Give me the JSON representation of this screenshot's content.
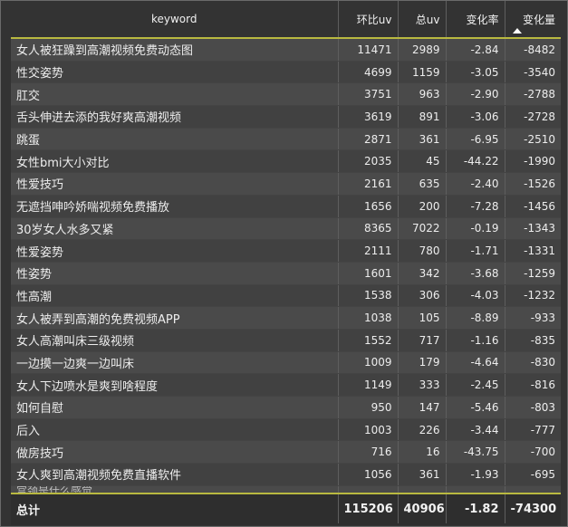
{
  "columns": {
    "keyword": "keyword",
    "prev_uv": "环比uv",
    "total_uv": "总uv",
    "change_rate": "变化率",
    "change_amount": "变化量"
  },
  "rows": [
    {
      "keyword": "女人被狂躁到高潮视频免费动态图",
      "prev_uv": "11471",
      "total_uv": "2989",
      "change_rate": "-2.84",
      "change_amount": "-8482"
    },
    {
      "keyword": "性交姿势",
      "prev_uv": "4699",
      "total_uv": "1159",
      "change_rate": "-3.05",
      "change_amount": "-3540"
    },
    {
      "keyword": "肛交",
      "prev_uv": "3751",
      "total_uv": "963",
      "change_rate": "-2.90",
      "change_amount": "-2788"
    },
    {
      "keyword": "舌头伸进去添的我好爽高潮视频",
      "prev_uv": "3619",
      "total_uv": "891",
      "change_rate": "-3.06",
      "change_amount": "-2728"
    },
    {
      "keyword": "跳蛋",
      "prev_uv": "2871",
      "total_uv": "361",
      "change_rate": "-6.95",
      "change_amount": "-2510"
    },
    {
      "keyword": "女性bmi大小对比",
      "prev_uv": "2035",
      "total_uv": "45",
      "change_rate": "-44.22",
      "change_amount": "-1990"
    },
    {
      "keyword": "性爱技巧",
      "prev_uv": "2161",
      "total_uv": "635",
      "change_rate": "-2.40",
      "change_amount": "-1526"
    },
    {
      "keyword": "无遮挡呻吟娇喘视频免费播放",
      "prev_uv": "1656",
      "total_uv": "200",
      "change_rate": "-7.28",
      "change_amount": "-1456"
    },
    {
      "keyword": "30岁女人水多又紧",
      "prev_uv": "8365",
      "total_uv": "7022",
      "change_rate": "-0.19",
      "change_amount": "-1343"
    },
    {
      "keyword": "性爱姿势",
      "prev_uv": "2111",
      "total_uv": "780",
      "change_rate": "-1.71",
      "change_amount": "-1331"
    },
    {
      "keyword": "性姿势",
      "prev_uv": "1601",
      "total_uv": "342",
      "change_rate": "-3.68",
      "change_amount": "-1259"
    },
    {
      "keyword": "性高潮",
      "prev_uv": "1538",
      "total_uv": "306",
      "change_rate": "-4.03",
      "change_amount": "-1232"
    },
    {
      "keyword": "女人被弄到高潮的免费视频APP",
      "prev_uv": "1038",
      "total_uv": "105",
      "change_rate": "-8.89",
      "change_amount": "-933"
    },
    {
      "keyword": "女人高潮叫床三级视频",
      "prev_uv": "1552",
      "total_uv": "717",
      "change_rate": "-1.16",
      "change_amount": "-835"
    },
    {
      "keyword": "一边摸一边爽一边叫床",
      "prev_uv": "1009",
      "total_uv": "179",
      "change_rate": "-4.64",
      "change_amount": "-830"
    },
    {
      "keyword": "女人下边喷水是爽到啥程度",
      "prev_uv": "1149",
      "total_uv": "333",
      "change_rate": "-2.45",
      "change_amount": "-816"
    },
    {
      "keyword": "如何自慰",
      "prev_uv": "950",
      "total_uv": "147",
      "change_rate": "-5.46",
      "change_amount": "-803"
    },
    {
      "keyword": "后入",
      "prev_uv": "1003",
      "total_uv": "226",
      "change_rate": "-3.44",
      "change_amount": "-777"
    },
    {
      "keyword": "做房技巧",
      "prev_uv": "716",
      "total_uv": "16",
      "change_rate": "-43.75",
      "change_amount": "-700"
    },
    {
      "keyword": "女人爽到高潮视频免费直播软件",
      "prev_uv": "1056",
      "total_uv": "361",
      "change_rate": "-1.93",
      "change_amount": "-695"
    }
  ],
  "partial_row": {
    "keyword": "宫颈是什么感觉",
    "prev_uv": "",
    "total_uv": "",
    "change_rate": "",
    "change_amount": ""
  },
  "totals": {
    "label": "总计",
    "prev_uv": "115206",
    "total_uv": "40906",
    "change_rate": "-1.82",
    "change_amount": "-74300"
  },
  "sort": {
    "column": "change_amount",
    "direction": "ascending",
    "icon": "sort-asc-icon"
  },
  "colors": {
    "accent_line": "#b9b940",
    "row_odd": "#4a4a4a",
    "row_even": "#414141"
  }
}
